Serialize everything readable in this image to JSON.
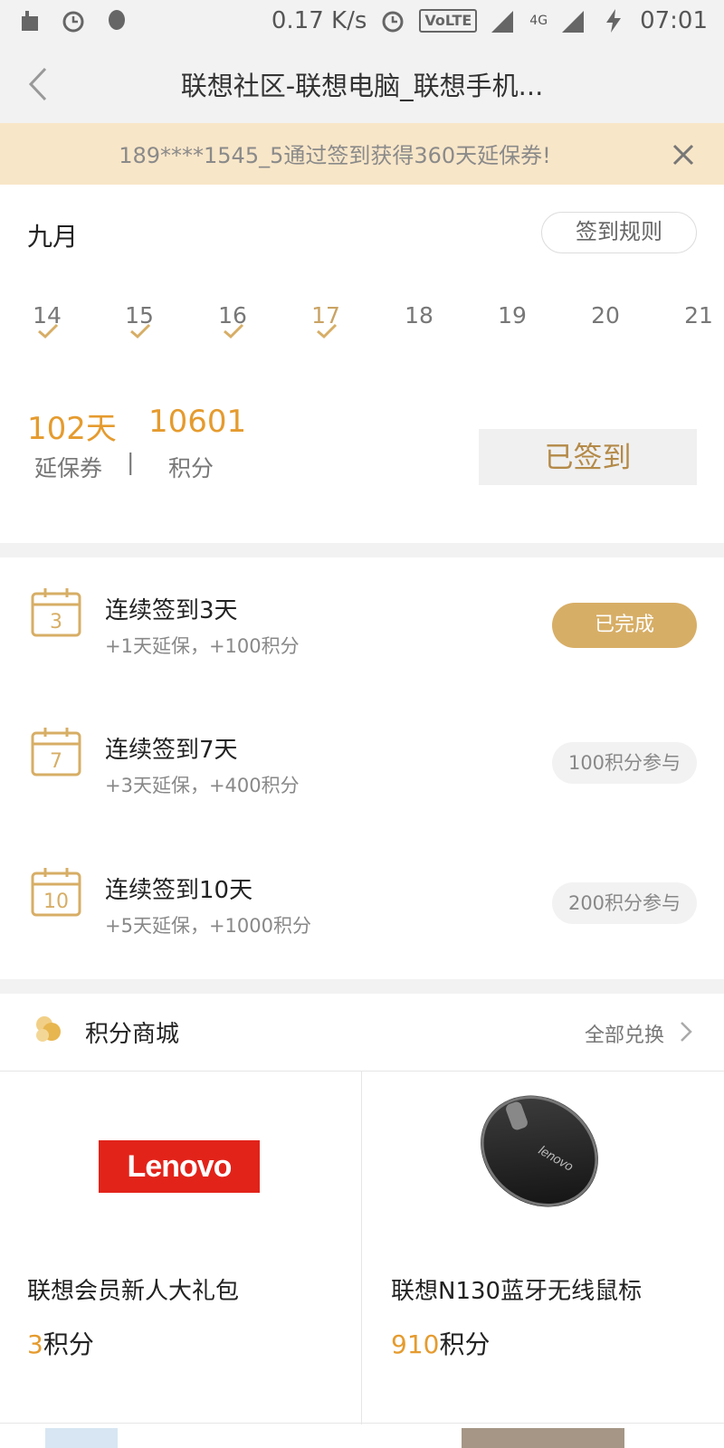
{
  "status_bar": {
    "speed": "0.17 K/s",
    "volte": "VoLTE",
    "network": "4G",
    "time": "07:01"
  },
  "header": {
    "title": "联想社区-联想电脑_联想手机..."
  },
  "notice": {
    "text": "189****1545_5通过签到获得360天延保券!"
  },
  "checkin": {
    "month": "九月",
    "rules_label": "签到规则",
    "days": [
      {
        "num": "14",
        "checked": true
      },
      {
        "num": "15",
        "checked": true
      },
      {
        "num": "16",
        "checked": true
      },
      {
        "num": "17",
        "checked": true,
        "today": true
      },
      {
        "num": "18",
        "checked": false
      },
      {
        "num": "19",
        "checked": false
      },
      {
        "num": "20",
        "checked": false
      },
      {
        "num": "21",
        "checked": false
      }
    ],
    "warranty_value": "102天",
    "warranty_label": "延保券",
    "separator": "|",
    "points_value": "10601",
    "points_label": "积分",
    "signed_label": "已签到"
  },
  "tasks": [
    {
      "icon_num": "3",
      "name": "连续签到3天",
      "desc": "+1天延保，+100积分",
      "button": "已完成",
      "done": true
    },
    {
      "icon_num": "7",
      "name": "连续签到7天",
      "desc": "+3天延保，+400积分",
      "button": "100积分参与",
      "done": false
    },
    {
      "icon_num": "10",
      "name": "连续签到10天",
      "desc": "+5天延保，+1000积分",
      "button": "200积分参与",
      "done": false
    }
  ],
  "mall": {
    "title": "积分商城",
    "all_label": "全部兑换",
    "products": [
      {
        "name": "联想会员新人大礼包",
        "price": "3",
        "unit": "积分",
        "logo_text": "Lenovo"
      },
      {
        "name": "联想N130蓝牙无线鼠标",
        "price": "910",
        "unit": "积分",
        "mouse_text": "lenovo"
      }
    ]
  },
  "colors": {
    "accent_orange": "#e59b2e",
    "gold": "#d7ae66",
    "notice_bg": "#f8e6c8",
    "lenovo_red": "#e2231a"
  }
}
